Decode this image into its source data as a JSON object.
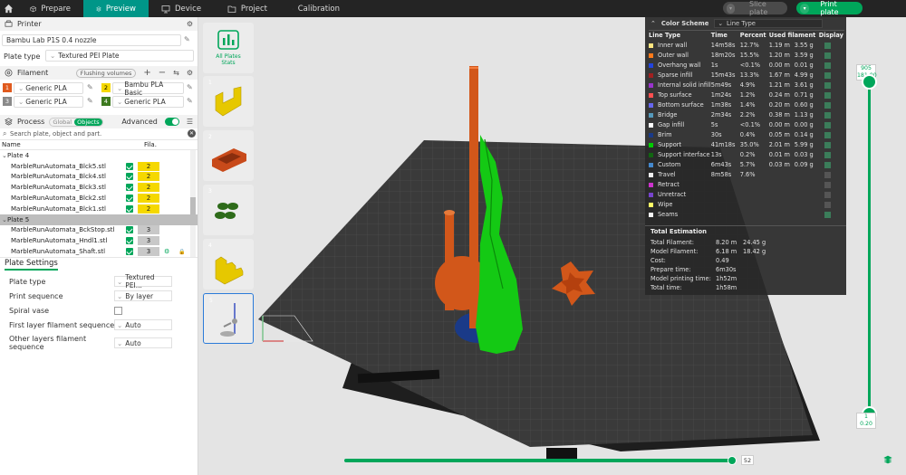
{
  "topbar": {
    "tabs": [
      {
        "label": "Prepare",
        "icon": "cube-icon",
        "active": false
      },
      {
        "label": "Preview",
        "icon": "preview-icon",
        "active": true
      },
      {
        "label": "Device",
        "icon": "monitor-icon",
        "active": false
      },
      {
        "label": "Project",
        "icon": "folder-icon",
        "active": false
      },
      {
        "label": "Calibration",
        "icon": "calibration-icon",
        "active": false
      }
    ],
    "slice_label": "Slice plate",
    "print_label": "Print plate"
  },
  "printer": {
    "section_title": "Printer",
    "printer_name": "Bambu Lab P1S 0.4 nozzle",
    "plate_type_label": "Plate type",
    "plate_type_value": "Textured PEI Plate"
  },
  "filament": {
    "section_title": "Filament",
    "flushing_label": "Flushing volumes",
    "slots": [
      {
        "num": "1",
        "name": "Generic PLA",
        "color": "#e05a1e"
      },
      {
        "num": "2",
        "name": "Bambu PLA Basic",
        "color": "#f5d800"
      },
      {
        "num": "3",
        "name": "Generic PLA",
        "color": "#8a8a8a"
      },
      {
        "num": "4",
        "name": "Generic PLA",
        "color": "#3d7a1f"
      }
    ]
  },
  "process": {
    "section_title": "Process",
    "global_label": "Global",
    "objects_label": "Objects",
    "advanced_label": "Advanced",
    "search_placeholder": "Search plate, object and part.",
    "col_name": "Name",
    "col_fila": "Fila.",
    "tree": [
      {
        "type": "plate",
        "label": "Plate 4"
      },
      {
        "type": "obj",
        "label": "MarbleRunAutomata_Blck5.stl",
        "fila": "2",
        "color": "#f5d800"
      },
      {
        "type": "obj",
        "label": "MarbleRunAutomata_Blck4.stl",
        "fila": "2",
        "color": "#f5d800"
      },
      {
        "type": "obj",
        "label": "MarbleRunAutomata_Blck3.stl",
        "fila": "2",
        "color": "#f5d800"
      },
      {
        "type": "obj",
        "label": "MarbleRunAutomata_Blck2.stl",
        "fila": "2",
        "color": "#f5d800"
      },
      {
        "type": "obj",
        "label": "MarbleRunAutomata_Blck1.stl",
        "fila": "2",
        "color": "#f5d800"
      },
      {
        "type": "plate-sel",
        "label": "Plate 5"
      },
      {
        "type": "obj",
        "label": "MarbleRunAutomata_BckStop.stl",
        "fila": "3",
        "color": "#c8c8c8"
      },
      {
        "type": "obj",
        "label": "MarbleRunAutomata_Hndl1.stl",
        "fila": "3",
        "color": "#c8c8c8"
      },
      {
        "type": "obj",
        "label": "MarbleRunAutomata_Shaft.stl",
        "fila": "3",
        "color": "#c8c8c8"
      }
    ]
  },
  "plate_settings": {
    "title": "Plate Settings",
    "rows": [
      {
        "label": "Plate type",
        "value": "Textured PEI..."
      },
      {
        "label": "Print sequence",
        "value": "By layer"
      },
      {
        "label": "Spiral vase",
        "value": ""
      },
      {
        "label": "First layer filament sequence",
        "value": "Auto"
      },
      {
        "label": "Other layers filament sequence",
        "value": "Auto"
      }
    ]
  },
  "plates_stats_label": "All Plates Stats",
  "plate_thumbs": [
    "1",
    "2",
    "3",
    "4",
    "5"
  ],
  "legend": {
    "title": "Color Scheme",
    "scheme": "Line Type",
    "headers": [
      "Line Type",
      "Time",
      "Percent",
      "Used filament",
      "Display"
    ],
    "rows": [
      {
        "name": "Inner wall",
        "color": "#ffe680",
        "time": "14m58s",
        "pct": "12.7%",
        "m": "1.19 m",
        "g": "3.55 g",
        "on": true
      },
      {
        "name": "Outer wall",
        "color": "#ff7a1a",
        "time": "18m20s",
        "pct": "15.5%",
        "m": "1.20 m",
        "g": "3.59 g",
        "on": true
      },
      {
        "name": "Overhang wall",
        "color": "#2244dd",
        "time": "1s",
        "pct": "<0.1%",
        "m": "0.00 m",
        "g": "0.01 g",
        "on": true
      },
      {
        "name": "Sparse infill",
        "color": "#a02020",
        "time": "15m43s",
        "pct": "13.3%",
        "m": "1.67 m",
        "g": "4.99 g",
        "on": true
      },
      {
        "name": "Internal solid infill",
        "color": "#9933cc",
        "time": "5m49s",
        "pct": "4.9%",
        "m": "1.21 m",
        "g": "3.61 g",
        "on": true
      },
      {
        "name": "Top surface",
        "color": "#ff5050",
        "time": "1m24s",
        "pct": "1.2%",
        "m": "0.24 m",
        "g": "0.71 g",
        "on": true
      },
      {
        "name": "Bottom surface",
        "color": "#6666ee",
        "time": "1m38s",
        "pct": "1.4%",
        "m": "0.20 m",
        "g": "0.60 g",
        "on": true
      },
      {
        "name": "Bridge",
        "color": "#5599bb",
        "time": "2m34s",
        "pct": "2.2%",
        "m": "0.38 m",
        "g": "1.13 g",
        "on": true
      },
      {
        "name": "Gap infill",
        "color": "#ffffff",
        "time": "5s",
        "pct": "<0.1%",
        "m": "0.00 m",
        "g": "0.00 g",
        "on": true
      },
      {
        "name": "Brim",
        "color": "#1a3a88",
        "time": "30s",
        "pct": "0.4%",
        "m": "0.05 m",
        "g": "0.14 g",
        "on": true
      },
      {
        "name": "Support",
        "color": "#00cc00",
        "time": "41m18s",
        "pct": "35.0%",
        "m": "2.01 m",
        "g": "5.99 g",
        "on": true
      },
      {
        "name": "Support interface",
        "color": "#116611",
        "time": "13s",
        "pct": "0.2%",
        "m": "0.01 m",
        "g": "0.03 g",
        "on": true
      },
      {
        "name": "Custom",
        "color": "#4488cc",
        "time": "6m43s",
        "pct": "5.7%",
        "m": "0.03 m",
        "g": "0.09 g",
        "on": true
      },
      {
        "name": "Travel",
        "color": "#f0f0f0",
        "time": "8m58s",
        "pct": "7.6%",
        "m": "",
        "g": "",
        "on": false
      },
      {
        "name": "Retract",
        "color": "#cc33cc",
        "time": "",
        "pct": "",
        "m": "",
        "g": "",
        "on": false
      },
      {
        "name": "Unretract",
        "color": "#7744cc",
        "time": "",
        "pct": "",
        "m": "",
        "g": "",
        "on": false
      },
      {
        "name": "Wipe",
        "color": "#ffff66",
        "time": "",
        "pct": "",
        "m": "",
        "g": "",
        "on": false
      },
      {
        "name": "Seams",
        "color": "#f5f5f5",
        "time": "",
        "pct": "",
        "m": "",
        "g": "",
        "on": true
      }
    ],
    "estimation_title": "Total Estimation",
    "estimation": [
      {
        "k": "Total Filament:",
        "v1": "8.20 m",
        "v2": "24.45 g"
      },
      {
        "k": "Model Filament:",
        "v1": "6.18 m",
        "v2": "18.42 g"
      },
      {
        "k": "Cost:",
        "v1": "0.49",
        "v2": ""
      },
      {
        "k": "Prepare time:",
        "v1": "6m30s",
        "v2": ""
      },
      {
        "k": "Model printing time:",
        "v1": "1h52m",
        "v2": ""
      },
      {
        "k": "Total time:",
        "v1": "1h58m",
        "v2": ""
      }
    ]
  },
  "vslider": {
    "top_layer": "905",
    "top_height": "181.00",
    "bottom_layer": "1",
    "bottom_height": "0.20"
  },
  "hslider": {
    "value": "52"
  }
}
